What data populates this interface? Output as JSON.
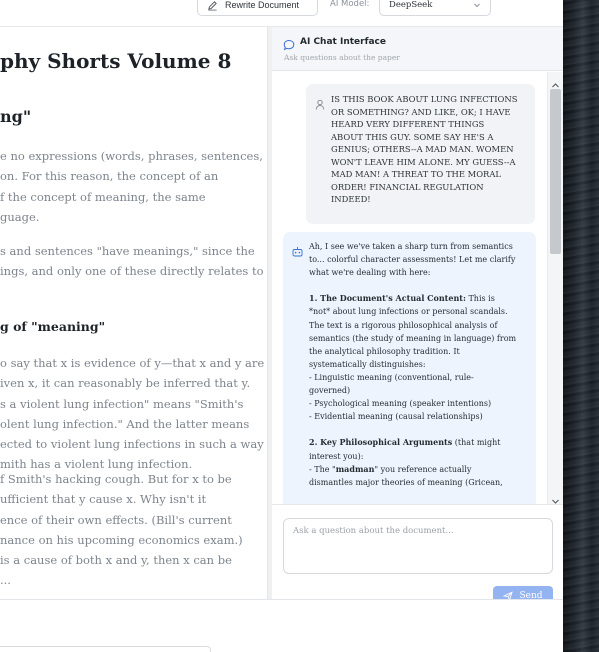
{
  "toolbar": {
    "rewrite_label": "Rewrite Document",
    "model_label": "AI Model:",
    "model_value": "DeepSeek"
  },
  "document": {
    "title": "phy Shorts Volume 8",
    "section_heading": "ng\"",
    "subheading": "g of \"meaning\"",
    "paragraphs": [
      "e no expressions (words, phrases, sentences,\non. For this reason, the concept of an\nf the concept of meaning, the same\nguage.",
      "s and sentences \"have meanings,\" since the\nings, and only one of these directly relates to",
      "o say that x is evidence of y—that x and y are\niven x, it can reasonably be inferred that y.\ns a violent lung infection\" means \"Smith's\nolent lung infection.\" And the latter means\nected to violent lung infections in such a way\nmith has a violent lung infection.",
      "f Smith's hacking cough. But for x to be\nufficient that y cause x. Why isn't it\nence of their own effects. (Bill's current\nnance on his upcoming economics exam.)\nis a cause of both x and y, then x can be\n..."
    ]
  },
  "chat": {
    "title": "AI Chat Interface",
    "subtitle": "Ask questions about the paper",
    "user_message": "IS THIS BOOK ABOUT LUNG INFECTIONS\nOR SOMETHING? AND LIKE, OK; I HAVE\nHEARD VERY DIFFERENT THINGS\nABOUT THIS GUY. SOME SAY HE'S A\nGENIUS; OTHERS--A MAD MAN. WOMEN\nWON'T LEAVE HIM ALONE. MY GUESS--A\nMAD MAN! A THREAT TO THE MORAL\nORDER! FINANCIAL REGULATION\nINDEED!",
    "ai_intro": "Ah, I see we've taken a sharp turn from semantics\nto... colorful character assessments! Let me clarify\nwhat we're dealing with here:",
    "ai_point1_title": "1. The Document's Actual Content:",
    "ai_point1_first": " This is",
    "ai_point1_body": "*not* about lung infections or personal scandals.\nThe text is a rigorous philosophical analysis of\nsemantics (the study of meaning in language) from\nthe analytical philosophy tradition. It\nsystematically distinguishes:\n- Linguistic meaning (conventional, rule-\ngoverned)\n- Psychological meaning (speaker intentions)\n- Evidential meaning (causal relationships)",
    "ai_point2_title": "2. Key Philosophical Arguments",
    "ai_point2_rest": " (that might\ninterest you):",
    "ai_point2_line_pre": "- The \"",
    "ai_point2_madman": "madman",
    "ai_point2_line_post": "\" you reference actually\ndismantles major theories of meaning (Gricean,",
    "input_placeholder": "Ask a question about the document...",
    "send_label": "Send"
  },
  "colors": {
    "accent": "#93b3f1",
    "ai_bubble": "#eef4fd",
    "user_bubble": "#f1f3f6"
  },
  "icons": [
    "pencil-icon",
    "chevron-down-icon",
    "chat-icon",
    "user-icon",
    "ai-icon",
    "send-icon",
    "scroll-up-icon",
    "scroll-down-icon"
  ]
}
